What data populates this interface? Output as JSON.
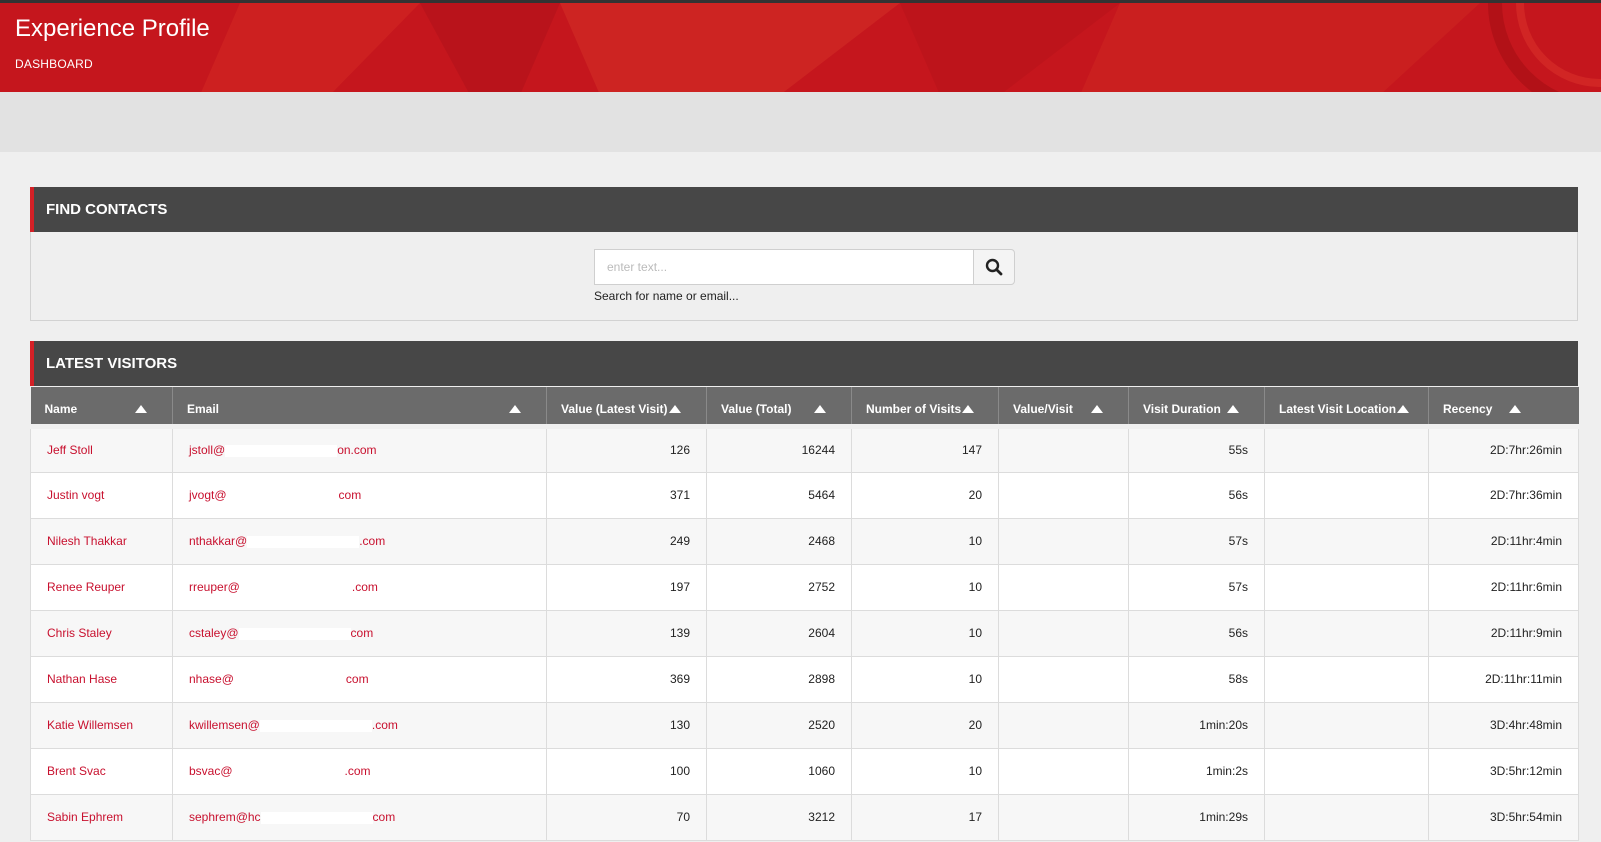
{
  "header": {
    "title": "Experience Profile",
    "subtitle": "DASHBOARD"
  },
  "find_contacts": {
    "title": "FIND CONTACTS",
    "search_placeholder": "enter text...",
    "search_hint": "Search for name or email...",
    "search_icon": "search-icon"
  },
  "latest_visitors": {
    "title": "LATEST VISITORS",
    "columns": [
      "Name",
      "Email",
      "Value (Latest Visit)",
      "Value (Total)",
      "Number of Visits",
      "Value/Visit",
      "Visit Duration",
      "Latest Visit Location",
      "Recency"
    ],
    "rows": [
      {
        "name": "Jeff Stoll",
        "email_start": "jstoll@",
        "email_end": "on.com",
        "value_latest": "126",
        "value_total": "16244",
        "visits": "147",
        "value_per_visit": "",
        "duration": "55s",
        "location": "",
        "recency": "2D:7hr:26min"
      },
      {
        "name": "Justin vogt",
        "email_start": "jvogt@",
        "email_end": "com",
        "value_latest": "371",
        "value_total": "5464",
        "visits": "20",
        "value_per_visit": "",
        "duration": "56s",
        "location": "",
        "recency": "2D:7hr:36min"
      },
      {
        "name": "Nilesh Thakkar",
        "email_start": "nthakkar@",
        "email_end": ".com",
        "value_latest": "249",
        "value_total": "2468",
        "visits": "10",
        "value_per_visit": "",
        "duration": "57s",
        "location": "",
        "recency": "2D:11hr:4min"
      },
      {
        "name": "Renee Reuper",
        "email_start": "rreuper@",
        "email_end": ".com",
        "value_latest": "197",
        "value_total": "2752",
        "visits": "10",
        "value_per_visit": "",
        "duration": "57s",
        "location": "",
        "recency": "2D:11hr:6min"
      },
      {
        "name": "Chris Staley",
        "email_start": "cstaley@",
        "email_end": "com",
        "value_latest": "139",
        "value_total": "2604",
        "visits": "10",
        "value_per_visit": "",
        "duration": "56s",
        "location": "",
        "recency": "2D:11hr:9min"
      },
      {
        "name": "Nathan Hase",
        "email_start": "nhase@",
        "email_end": "com",
        "value_latest": "369",
        "value_total": "2898",
        "visits": "10",
        "value_per_visit": "",
        "duration": "58s",
        "location": "",
        "recency": "2D:11hr:11min"
      },
      {
        "name": "Katie Willemsen",
        "email_start": "kwillemsen@",
        "email_end": ".com",
        "value_latest": "130",
        "value_total": "2520",
        "visits": "20",
        "value_per_visit": "",
        "duration": "1min:20s",
        "location": "",
        "recency": "3D:4hr:48min"
      },
      {
        "name": "Brent Svac",
        "email_start": "bsvac@",
        "email_end": ".com",
        "value_latest": "100",
        "value_total": "1060",
        "visits": "10",
        "value_per_visit": "",
        "duration": "1min:2s",
        "location": "",
        "recency": "3D:5hr:12min"
      },
      {
        "name": "Sabin Ephrem",
        "email_start": "sephrem@hc",
        "email_end": "com",
        "value_latest": "70",
        "value_total": "3212",
        "visits": "17",
        "value_per_visit": "",
        "duration": "1min:29s",
        "location": "",
        "recency": "3D:5hr:54min"
      }
    ]
  },
  "colors": {
    "brand_red": "#c5161d",
    "link_red": "#c8102e",
    "panel_dark": "#474747",
    "table_header": "#6b6b6b"
  }
}
